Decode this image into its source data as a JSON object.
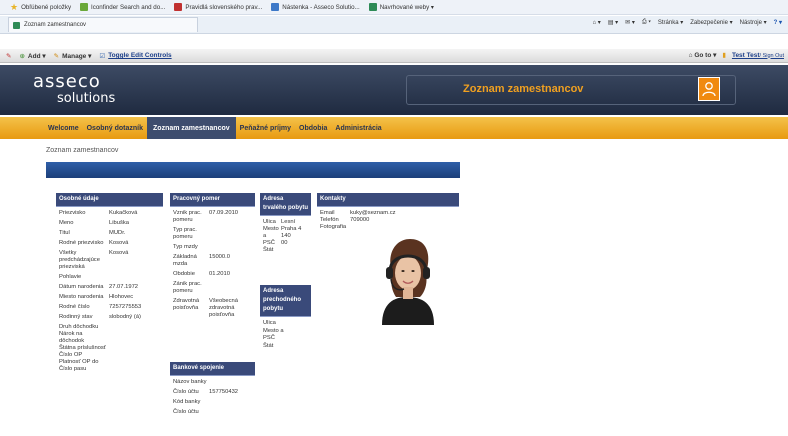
{
  "browser": {
    "favorites": [
      {
        "label": "Obľúbené položky"
      },
      {
        "label": "Iconfinder Search and do..."
      },
      {
        "label": "Pravidlá slovenského prav..."
      },
      {
        "label": "Nástenka - Asseco Solutio..."
      },
      {
        "label": "Navrhované weby ▾"
      }
    ],
    "tab_title": "Zoznam zamestnancov",
    "commands": [
      "Stránka ▾",
      "Zabezpečenie ▾",
      "Nástroje ▾"
    ]
  },
  "sp_toolbar": {
    "add": "Add ▾",
    "manage": "Manage ▾",
    "toggle": "Toggle Edit Controls",
    "goto": "Go to ▾",
    "user": "Test Test",
    "signout": "/ Sign Out"
  },
  "header": {
    "logo_top": "asseco",
    "logo_bottom": "solutions",
    "page_title": "Zoznam zamestnancov"
  },
  "nav": [
    {
      "label": "Welcome",
      "active": false
    },
    {
      "label": "Osobný dotazník",
      "active": false
    },
    {
      "label": "Zoznam zamestnancov",
      "active": true
    },
    {
      "label": "Peňažné príjmy",
      "active": false
    },
    {
      "label": "Obdobia",
      "active": false
    },
    {
      "label": "Administrácia",
      "active": false
    }
  ],
  "breadcrumb": "Zoznam zamestnancov",
  "osobne": {
    "title": "Osobné údaje",
    "rows": [
      {
        "label": "Priezvisko",
        "value": "Kukačková"
      },
      {
        "label": "Meno",
        "value": "Libuška"
      },
      {
        "label": "Titul",
        "value": "MUDr."
      },
      {
        "label": "Rodné priezvisko",
        "value": "Kosová"
      },
      {
        "label": "Všetky predchádzajúce priezviská",
        "value": "Kosová"
      },
      {
        "label": "Pohlavie",
        "value": ""
      },
      {
        "label": "Dátum narodenia",
        "value": "27.07.1972"
      },
      {
        "label": "Miesto narodenia",
        "value": "Hlohovec"
      },
      {
        "label": "Rodné číslo",
        "value": "7257275553"
      },
      {
        "label": "Rodinný stav",
        "value": "slobodný (á)"
      },
      {
        "label": "Druh dôchodku",
        "value": ""
      },
      {
        "label": "Nárok na dôchodok",
        "value": ""
      },
      {
        "label": "Štátna príslušnosť",
        "value": ""
      },
      {
        "label": "Číslo OP",
        "value": ""
      },
      {
        "label": "Platnosť OP do",
        "value": ""
      },
      {
        "label": "Číslo pasu",
        "value": ""
      }
    ]
  },
  "pracovny": {
    "title": "Pracovný pomer",
    "rows": [
      {
        "label": "Vznik prac. pomeru",
        "value": "07.09.2010"
      },
      {
        "label": "Typ prac. pomeru",
        "value": ""
      },
      {
        "label": "Typ mzdy",
        "value": ""
      },
      {
        "label": "Základná mzda",
        "value": "15000.0"
      },
      {
        "label": "Obdobie",
        "value": "01.2010"
      },
      {
        "label": "Zánik prac. pomeru",
        "value": ""
      },
      {
        "label": "Zdravotná poisťovňa",
        "value": "Všeobecná zdravotná poisťovňa"
      }
    ]
  },
  "bankove": {
    "title": "Bankové spojenie",
    "rows": [
      {
        "label": "Názov banky",
        "value": ""
      },
      {
        "label": "Číslo účtu",
        "value": "157750432"
      },
      {
        "label": "Kód banky",
        "value": ""
      },
      {
        "label": "Číslo účtu",
        "value": ""
      }
    ]
  },
  "adresa_trvala": {
    "title": "Adresa trvalého pobytu",
    "rows": [
      {
        "label": "Ulica",
        "value": "Lesní"
      },
      {
        "label": "Mesto a",
        "value": "Praha 4 140"
      },
      {
        "label": "PSČ",
        "value": "00"
      },
      {
        "label": "Štát",
        "value": ""
      }
    ]
  },
  "adresa_prechodna": {
    "title": "Adresa prechodného pobytu",
    "rows": [
      {
        "label": "Ulica",
        "value": ""
      },
      {
        "label": "Mesto a PSČ",
        "value": ""
      },
      {
        "label": "Štát",
        "value": ""
      }
    ]
  },
  "kontakty": {
    "title": "Kontakty",
    "rows": [
      {
        "label": "Email",
        "value": "kuky@seznam.cz"
      },
      {
        "label": "Telefón",
        "value": "709000"
      },
      {
        "label": "Fotografia",
        "value": ""
      }
    ]
  },
  "colors": {
    "header_dark": "#1f2a40",
    "nav_orange": "#e89a10",
    "section_head": "#3a4a7a",
    "accent": "#f08a10"
  }
}
